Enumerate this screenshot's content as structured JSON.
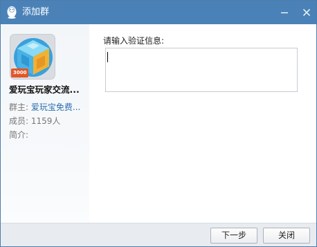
{
  "window": {
    "title": "添加群",
    "app_icon": "qq-penguin-icon"
  },
  "group": {
    "name": "爱玩宝玩家交流...",
    "avatar_badge": "3000",
    "owner_label": "群主:",
    "owner_value": "爱玩宝免费...",
    "members_label": "成员:",
    "members_value": "1159人",
    "intro_label": "简介:",
    "intro_value": ""
  },
  "form": {
    "prompt": "请输入验证信息:",
    "verify_value": ""
  },
  "footer": {
    "next_label": "下一步",
    "close_label": "关闭"
  },
  "colors": {
    "titlebar": "#4a82b8",
    "link": "#2a6eb0",
    "badge": "#e2562a"
  }
}
